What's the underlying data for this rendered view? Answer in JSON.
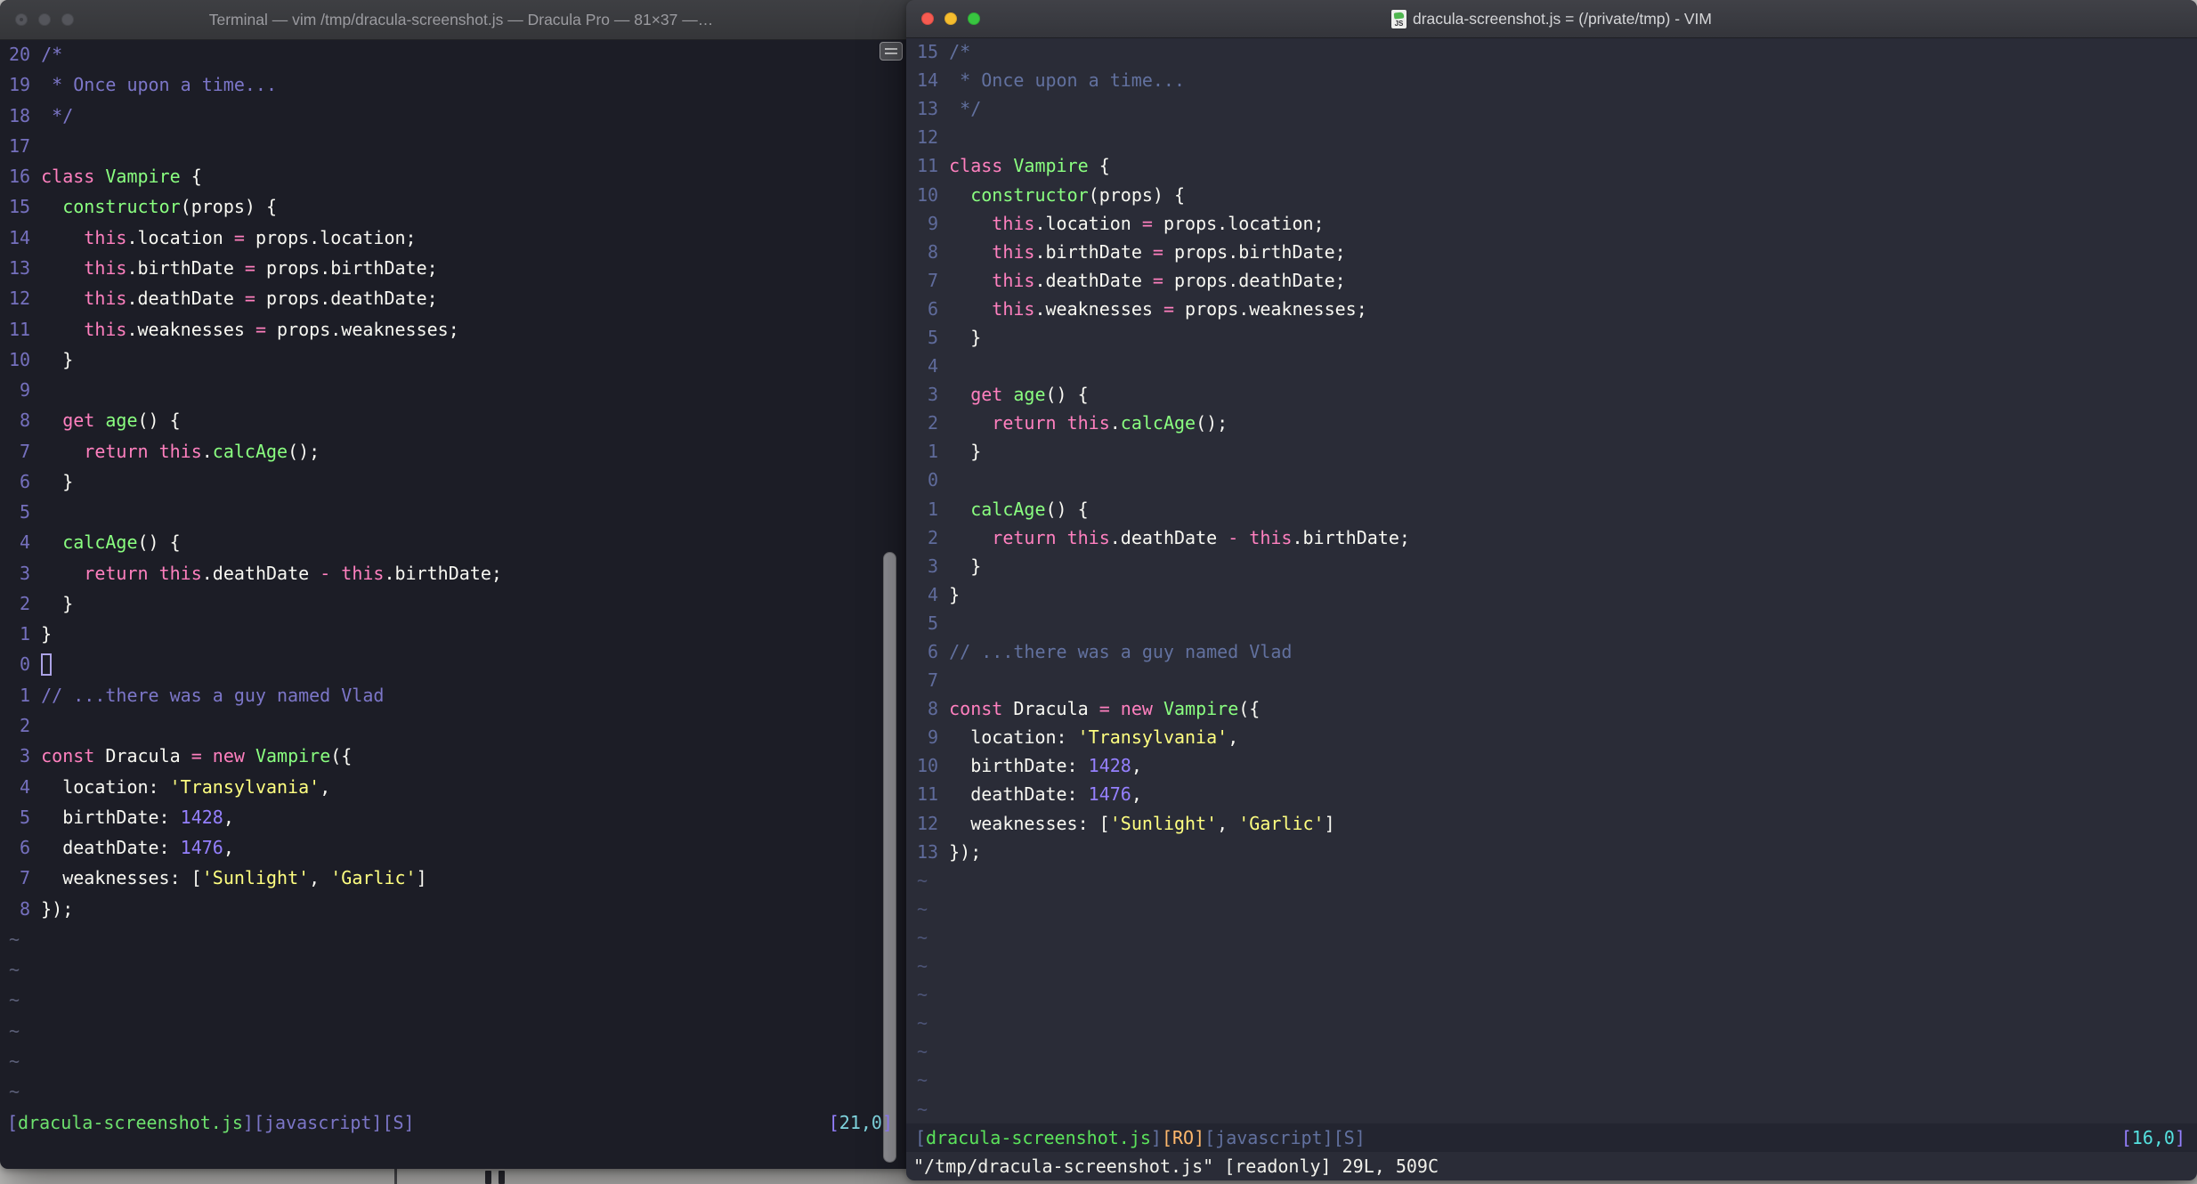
{
  "tilde_char": "~",
  "colors": {
    "pink": "#FF80BF",
    "green": "#8AFF80",
    "yellow": "#FFFF80",
    "purple": "#9580FF",
    "fg": "#F8F8F2",
    "left": {
      "bg": "#1C1D26",
      "comment": "#7C76C8",
      "linenr": "#7570BE",
      "tilde": "#5B5F78",
      "status_file": "#6EE26E",
      "status_meta": "#7C76C8",
      "status_pos": "#7FD4DE",
      "cursor": "#ACA3E6"
    },
    "right": {
      "bg": "#2A2C37",
      "comment": "#62719F",
      "linenr": "#5F6B9B",
      "tilde": "#4C5476",
      "status_file": "#5BE35B",
      "status_meta": "#62719F",
      "status_ro": "#FFB86C",
      "status_pos": "#55E2E0"
    }
  },
  "left_window": {
    "title": "Terminal — vim /tmp/dracula-screenshot.js — Dracula Pro — 81×37 —…",
    "tilde_count": 6,
    "command": "",
    "status": {
      "file_open": "[",
      "file": "dracula-screenshot.js",
      "file_close": "]",
      "meta": "[javascript][S]",
      "pos_open": "[",
      "pos": "21,0",
      "pos_close": "]"
    },
    "lines": [
      {
        "n": "20",
        "s": [
          [
            "/*",
            "c"
          ]
        ]
      },
      {
        "n": "19",
        "s": [
          [
            " * Once upon a time...",
            "c"
          ]
        ]
      },
      {
        "n": "18",
        "s": [
          [
            " */",
            "c"
          ]
        ]
      },
      {
        "n": "17",
        "s": []
      },
      {
        "n": "16",
        "s": [
          [
            "class",
            "k"
          ],
          [
            " ",
            "w"
          ],
          [
            "Vampire",
            "f"
          ],
          [
            " {",
            "w"
          ]
        ]
      },
      {
        "n": "15",
        "s": [
          [
            "  ",
            "w"
          ],
          [
            "constructor",
            "f"
          ],
          [
            "(props) {",
            "w"
          ]
        ]
      },
      {
        "n": "14",
        "s": [
          [
            "    ",
            "w"
          ],
          [
            "this",
            "k"
          ],
          [
            ".location ",
            "w"
          ],
          [
            "=",
            "k"
          ],
          [
            " props.location;",
            "w"
          ]
        ]
      },
      {
        "n": "13",
        "s": [
          [
            "    ",
            "w"
          ],
          [
            "this",
            "k"
          ],
          [
            ".birthDate ",
            "w"
          ],
          [
            "=",
            "k"
          ],
          [
            " props.birthDate;",
            "w"
          ]
        ]
      },
      {
        "n": "12",
        "s": [
          [
            "    ",
            "w"
          ],
          [
            "this",
            "k"
          ],
          [
            ".deathDate ",
            "w"
          ],
          [
            "=",
            "k"
          ],
          [
            " props.deathDate;",
            "w"
          ]
        ]
      },
      {
        "n": "11",
        "s": [
          [
            "    ",
            "w"
          ],
          [
            "this",
            "k"
          ],
          [
            ".weaknesses ",
            "w"
          ],
          [
            "=",
            "k"
          ],
          [
            " props.weaknesses;",
            "w"
          ]
        ]
      },
      {
        "n": "10",
        "s": [
          [
            "  }",
            "w"
          ]
        ]
      },
      {
        "n": "9",
        "s": []
      },
      {
        "n": "8",
        "s": [
          [
            "  ",
            "w"
          ],
          [
            "get",
            "k"
          ],
          [
            " ",
            "w"
          ],
          [
            "age",
            "f"
          ],
          [
            "() {",
            "w"
          ]
        ]
      },
      {
        "n": "7",
        "s": [
          [
            "    ",
            "w"
          ],
          [
            "return",
            "k"
          ],
          [
            " ",
            "w"
          ],
          [
            "this",
            "k"
          ],
          [
            ".",
            "w"
          ],
          [
            "calcAge",
            "f"
          ],
          [
            "();",
            "w"
          ]
        ]
      },
      {
        "n": "6",
        "s": [
          [
            "  }",
            "w"
          ]
        ]
      },
      {
        "n": "5",
        "s": []
      },
      {
        "n": "4",
        "s": [
          [
            "  ",
            "w"
          ],
          [
            "calcAge",
            "f"
          ],
          [
            "() {",
            "w"
          ]
        ]
      },
      {
        "n": "3",
        "s": [
          [
            "    ",
            "w"
          ],
          [
            "return",
            "k"
          ],
          [
            " ",
            "w"
          ],
          [
            "this",
            "k"
          ],
          [
            ".deathDate ",
            "w"
          ],
          [
            "-",
            "k"
          ],
          [
            " ",
            "w"
          ],
          [
            "this",
            "k"
          ],
          [
            ".birthDate;",
            "w"
          ]
        ]
      },
      {
        "n": "2",
        "s": [
          [
            "  }",
            "w"
          ]
        ]
      },
      {
        "n": "1",
        "s": [
          [
            "}",
            "w"
          ]
        ]
      },
      {
        "n": "0",
        "cursor": true,
        "s": []
      },
      {
        "n": "1",
        "s": [
          [
            "// ...there was a guy named Vlad",
            "c"
          ]
        ]
      },
      {
        "n": "2",
        "s": []
      },
      {
        "n": "3",
        "s": [
          [
            "const",
            "k"
          ],
          [
            " Dracula ",
            "w"
          ],
          [
            "=",
            "k"
          ],
          [
            " ",
            "w"
          ],
          [
            "new",
            "k"
          ],
          [
            " ",
            "w"
          ],
          [
            "Vampire",
            "f"
          ],
          [
            "({",
            "w"
          ]
        ]
      },
      {
        "n": "4",
        "s": [
          [
            "  location: ",
            "w"
          ],
          [
            "'Transylvania'",
            "s"
          ],
          [
            ",",
            "w"
          ]
        ]
      },
      {
        "n": "5",
        "s": [
          [
            "  birthDate: ",
            "w"
          ],
          [
            "1428",
            "n"
          ],
          [
            ",",
            "w"
          ]
        ]
      },
      {
        "n": "6",
        "s": [
          [
            "  deathDate: ",
            "w"
          ],
          [
            "1476",
            "n"
          ],
          [
            ",",
            "w"
          ]
        ]
      },
      {
        "n": "7",
        "s": [
          [
            "  weaknesses: [",
            "w"
          ],
          [
            "'Sunlight'",
            "s"
          ],
          [
            ", ",
            "w"
          ],
          [
            "'Garlic'",
            "s"
          ],
          [
            "]",
            "w"
          ]
        ]
      },
      {
        "n": "8",
        "s": [
          [
            "});",
            "w"
          ]
        ]
      }
    ]
  },
  "right_window": {
    "title": "dracula-screenshot.js = (/private/tmp) - VIM",
    "icon_label": "JS",
    "tilde_count": 9,
    "command": "\"/tmp/dracula-screenshot.js\" [readonly] 29L, 509C",
    "status": {
      "file_open": "[",
      "file": "dracula-screenshot.js",
      "file_close": "]",
      "ro": "[RO]",
      "meta": "[javascript][S]",
      "pos_open": "[",
      "pos": "16,0",
      "pos_close": "]"
    },
    "lines": [
      {
        "n": "15",
        "s": [
          [
            "/*",
            "c"
          ]
        ]
      },
      {
        "n": "14",
        "s": [
          [
            " * Once upon a time...",
            "c"
          ]
        ]
      },
      {
        "n": "13",
        "s": [
          [
            " */",
            "c"
          ]
        ]
      },
      {
        "n": "12",
        "s": []
      },
      {
        "n": "11",
        "s": [
          [
            "class",
            "k"
          ],
          [
            " ",
            "w"
          ],
          [
            "Vampire",
            "f"
          ],
          [
            " {",
            "w"
          ]
        ]
      },
      {
        "n": "10",
        "s": [
          [
            "  ",
            "w"
          ],
          [
            "constructor",
            "f"
          ],
          [
            "(props) {",
            "w"
          ]
        ]
      },
      {
        "n": "9",
        "s": [
          [
            "    ",
            "w"
          ],
          [
            "this",
            "k"
          ],
          [
            ".location ",
            "w"
          ],
          [
            "=",
            "k"
          ],
          [
            " props.location;",
            "w"
          ]
        ]
      },
      {
        "n": "8",
        "s": [
          [
            "    ",
            "w"
          ],
          [
            "this",
            "k"
          ],
          [
            ".birthDate ",
            "w"
          ],
          [
            "=",
            "k"
          ],
          [
            " props.birthDate;",
            "w"
          ]
        ]
      },
      {
        "n": "7",
        "s": [
          [
            "    ",
            "w"
          ],
          [
            "this",
            "k"
          ],
          [
            ".deathDate ",
            "w"
          ],
          [
            "=",
            "k"
          ],
          [
            " props.deathDate;",
            "w"
          ]
        ]
      },
      {
        "n": "6",
        "s": [
          [
            "    ",
            "w"
          ],
          [
            "this",
            "k"
          ],
          [
            ".weaknesses ",
            "w"
          ],
          [
            "=",
            "k"
          ],
          [
            " props.weaknesses;",
            "w"
          ]
        ]
      },
      {
        "n": "5",
        "s": [
          [
            "  }",
            "w"
          ]
        ]
      },
      {
        "n": "4",
        "s": []
      },
      {
        "n": "3",
        "s": [
          [
            "  ",
            "w"
          ],
          [
            "get",
            "k"
          ],
          [
            " ",
            "w"
          ],
          [
            "age",
            "f"
          ],
          [
            "() {",
            "w"
          ]
        ]
      },
      {
        "n": "2",
        "s": [
          [
            "    ",
            "w"
          ],
          [
            "return",
            "k"
          ],
          [
            " ",
            "w"
          ],
          [
            "this",
            "k"
          ],
          [
            ".",
            "w"
          ],
          [
            "calcAge",
            "f"
          ],
          [
            "();",
            "w"
          ]
        ]
      },
      {
        "n": "1",
        "s": [
          [
            "  }",
            "w"
          ]
        ]
      },
      {
        "n": "0",
        "s": []
      },
      {
        "n": "1",
        "s": [
          [
            "  ",
            "w"
          ],
          [
            "calcAge",
            "f"
          ],
          [
            "() {",
            "w"
          ]
        ]
      },
      {
        "n": "2",
        "s": [
          [
            "    ",
            "w"
          ],
          [
            "return",
            "k"
          ],
          [
            " ",
            "w"
          ],
          [
            "this",
            "k"
          ],
          [
            ".deathDate ",
            "w"
          ],
          [
            "-",
            "k"
          ],
          [
            " ",
            "w"
          ],
          [
            "this",
            "k"
          ],
          [
            ".birthDate;",
            "w"
          ]
        ]
      },
      {
        "n": "3",
        "s": [
          [
            "  }",
            "w"
          ]
        ]
      },
      {
        "n": "4",
        "s": [
          [
            "}",
            "w"
          ]
        ]
      },
      {
        "n": "5",
        "s": []
      },
      {
        "n": "6",
        "s": [
          [
            "// ...there was a guy named Vlad",
            "c"
          ]
        ]
      },
      {
        "n": "7",
        "s": []
      },
      {
        "n": "8",
        "s": [
          [
            "const",
            "k"
          ],
          [
            " Dracula ",
            "w"
          ],
          [
            "=",
            "k"
          ],
          [
            " ",
            "w"
          ],
          [
            "new",
            "k"
          ],
          [
            " ",
            "w"
          ],
          [
            "Vampire",
            "f"
          ],
          [
            "({",
            "w"
          ]
        ]
      },
      {
        "n": "9",
        "s": [
          [
            "  location: ",
            "w"
          ],
          [
            "'Transylvania'",
            "s"
          ],
          [
            ",",
            "w"
          ]
        ]
      },
      {
        "n": "10",
        "s": [
          [
            "  birthDate: ",
            "w"
          ],
          [
            "1428",
            "n"
          ],
          [
            ",",
            "w"
          ]
        ]
      },
      {
        "n": "11",
        "s": [
          [
            "  deathDate: ",
            "w"
          ],
          [
            "1476",
            "n"
          ],
          [
            ",",
            "w"
          ]
        ]
      },
      {
        "n": "12",
        "s": [
          [
            "  weaknesses: [",
            "w"
          ],
          [
            "'Sunlight'",
            "s"
          ],
          [
            ", ",
            "w"
          ],
          [
            "'Garlic'",
            "s"
          ],
          [
            "]",
            "w"
          ]
        ]
      },
      {
        "n": "13",
        "s": [
          [
            "});",
            "w"
          ]
        ]
      }
    ]
  }
}
